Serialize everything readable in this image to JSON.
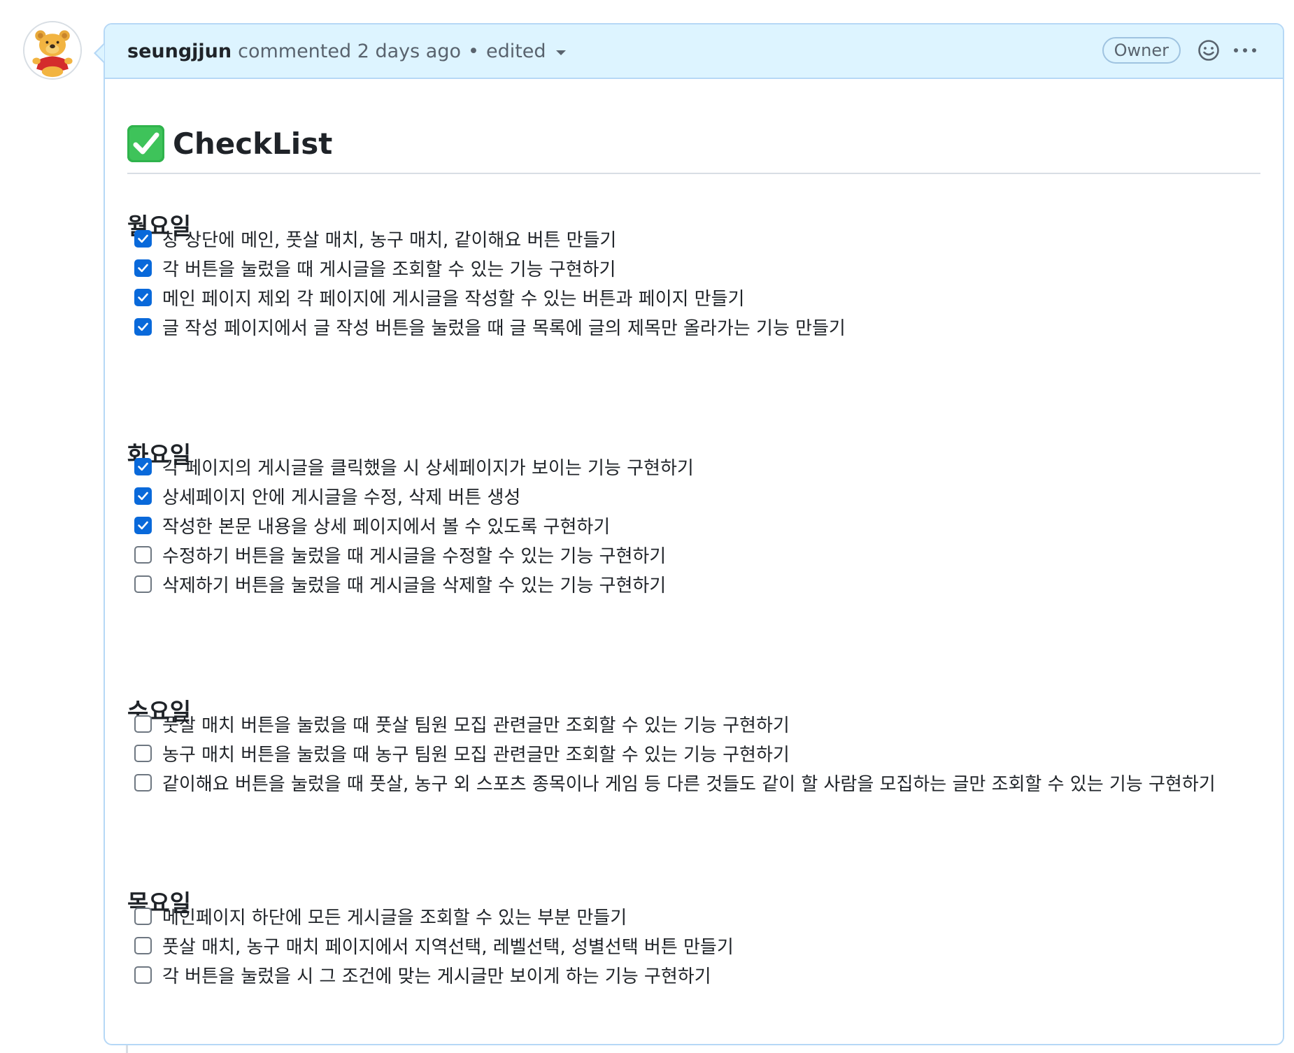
{
  "comment": {
    "author": "seungjjun",
    "action": "commented",
    "time": "2 days ago",
    "separator": "•",
    "edited": "edited",
    "badge": "Owner",
    "avatar_icon": "winnie-the-pooh-avatar",
    "accent_border": "#b6d8f6",
    "header_bg": "#ddf4ff"
  },
  "body": {
    "title_emoji": "white-check-mark-icon",
    "title": "CheckList",
    "sections": [
      {
        "heading": "월요일",
        "tasks": [
          {
            "text": "창 상단에 메인, 풋살 매치, 농구 매치, 같이해요 버튼 만들기",
            "checked": true
          },
          {
            "text": "각 버튼을 눌렀을 때 게시글을 조회할 수 있는 기능 구현하기",
            "checked": true
          },
          {
            "text": "메인 페이지 제외 각 페이지에 게시글을 작성할 수 있는 버튼과 페이지 만들기",
            "checked": true
          },
          {
            "text": "글 작성 페이지에서 글 작성 버튼을 눌렀을 때 글 목록에 글의 제목만 올라가는 기능 만들기",
            "checked": true
          }
        ]
      },
      {
        "heading": "화요일",
        "tasks": [
          {
            "text": "각 페이지의 게시글을 클릭했을 시 상세페이지가 보이는 기능 구현하기",
            "checked": true
          },
          {
            "text": "상세페이지 안에 게시글을 수정, 삭제 버튼 생성",
            "checked": true
          },
          {
            "text": "작성한 본문 내용을 상세 페이지에서 볼 수 있도록 구현하기",
            "checked": true
          },
          {
            "text": "수정하기 버튼을 눌렀을 때 게시글을 수정할 수 있는 기능 구현하기",
            "checked": false
          },
          {
            "text": "삭제하기 버튼을 눌렀을 때 게시글을 삭제할 수 있는 기능 구현하기",
            "checked": false
          }
        ]
      },
      {
        "heading": "수요일",
        "tasks": [
          {
            "text": "풋살 매치 버튼을 눌렀을 때 풋살 팀원 모집 관련글만 조회할 수 있는 기능 구현하기",
            "checked": false
          },
          {
            "text": "농구 매치 버튼을 눌렀을 때 농구 팀원 모집 관련글만 조회할 수 있는 기능 구현하기",
            "checked": false
          },
          {
            "text": "같이해요 버튼을 눌렀을 때 풋살, 농구 외 스포츠 종목이나 게임 등 다른 것들도 같이 할 사람을 모집하는 글만 조회할 수 있는 기능 구현하기",
            "checked": false
          }
        ]
      },
      {
        "heading": "목요일",
        "tasks": [
          {
            "text": "메인페이지 하단에 모든 게시글을 조회할 수 있는 부분 만들기",
            "checked": false
          },
          {
            "text": "풋살 매치, 농구 매치 페이지에서 지역선택, 레벨선택, 성별선택 버튼 만들기",
            "checked": false
          },
          {
            "text": "각 버튼을 눌렀을 시 그 조건에 맞는 게시글만 보이게 하는 기능 구현하기",
            "checked": false
          }
        ]
      }
    ]
  },
  "colors": {
    "checkbox_checked": "#0969da",
    "checkbox_unchecked_border": "#6e7781",
    "text": "#1f2328",
    "muted": "#59636e"
  }
}
